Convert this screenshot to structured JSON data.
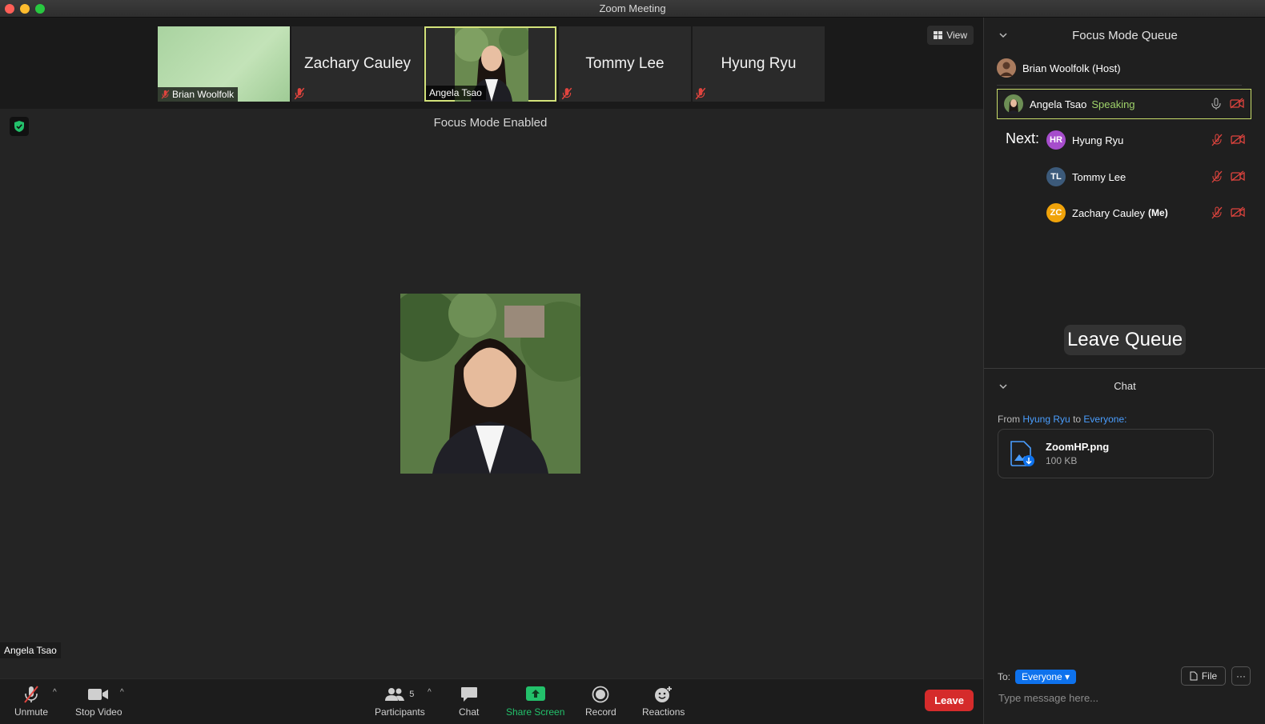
{
  "window": {
    "title": "Zoom Meeting"
  },
  "gallery": {
    "tiles": [
      {
        "name": "Brian Woolfolk"
      },
      {
        "name": "Zachary Cauley"
      },
      {
        "name": "Angela Tsao"
      },
      {
        "name": "Tommy Lee"
      },
      {
        "name": "Hyung Ryu"
      }
    ],
    "view_label": "View"
  },
  "stage": {
    "banner": "Focus Mode Enabled",
    "speaker_name": "Angela Tsao"
  },
  "toolbar": {
    "unmute": "Unmute",
    "stop_video": "Stop Video",
    "participants": "Participants",
    "participant_count": "5",
    "chat": "Chat",
    "share_screen": "Share Screen",
    "record": "Record",
    "reactions": "Reactions",
    "leave": "Leave"
  },
  "queue": {
    "title": "Focus Mode Queue",
    "host": "Brian Woolfolk (Host)",
    "current": {
      "name": "Angela Tsao",
      "status": "Speaking"
    },
    "next_label": "Next:",
    "next": [
      {
        "initials": "HR",
        "name": "Hyung Ryu",
        "suffix": "",
        "color": "#a64dcc"
      },
      {
        "initials": "TL",
        "name": "Tommy Lee",
        "suffix": "",
        "color": "#3c5a7a"
      },
      {
        "initials": "ZC",
        "name": "Zachary Cauley",
        "suffix": "(Me)",
        "color": "#f0a30a"
      }
    ],
    "leave_button": "Leave Queue"
  },
  "chat": {
    "title": "Chat",
    "from_prefix": "From",
    "from_sender": "Hyung Ryu",
    "from_to": "to",
    "from_recipient": "Everyone:",
    "file": {
      "name": "ZoomHP.png",
      "size": "100 KB"
    },
    "to_label": "To:",
    "to_value": "Everyone",
    "file_button": "File",
    "more_button": "···",
    "input_placeholder": "Type message here..."
  },
  "colors": {
    "accent": "#0e72ed",
    "leave_red": "#d52b2b",
    "speaking_green": "#9fd36a",
    "active_border": "#d3e27a",
    "muted_red": "#e0443e"
  }
}
